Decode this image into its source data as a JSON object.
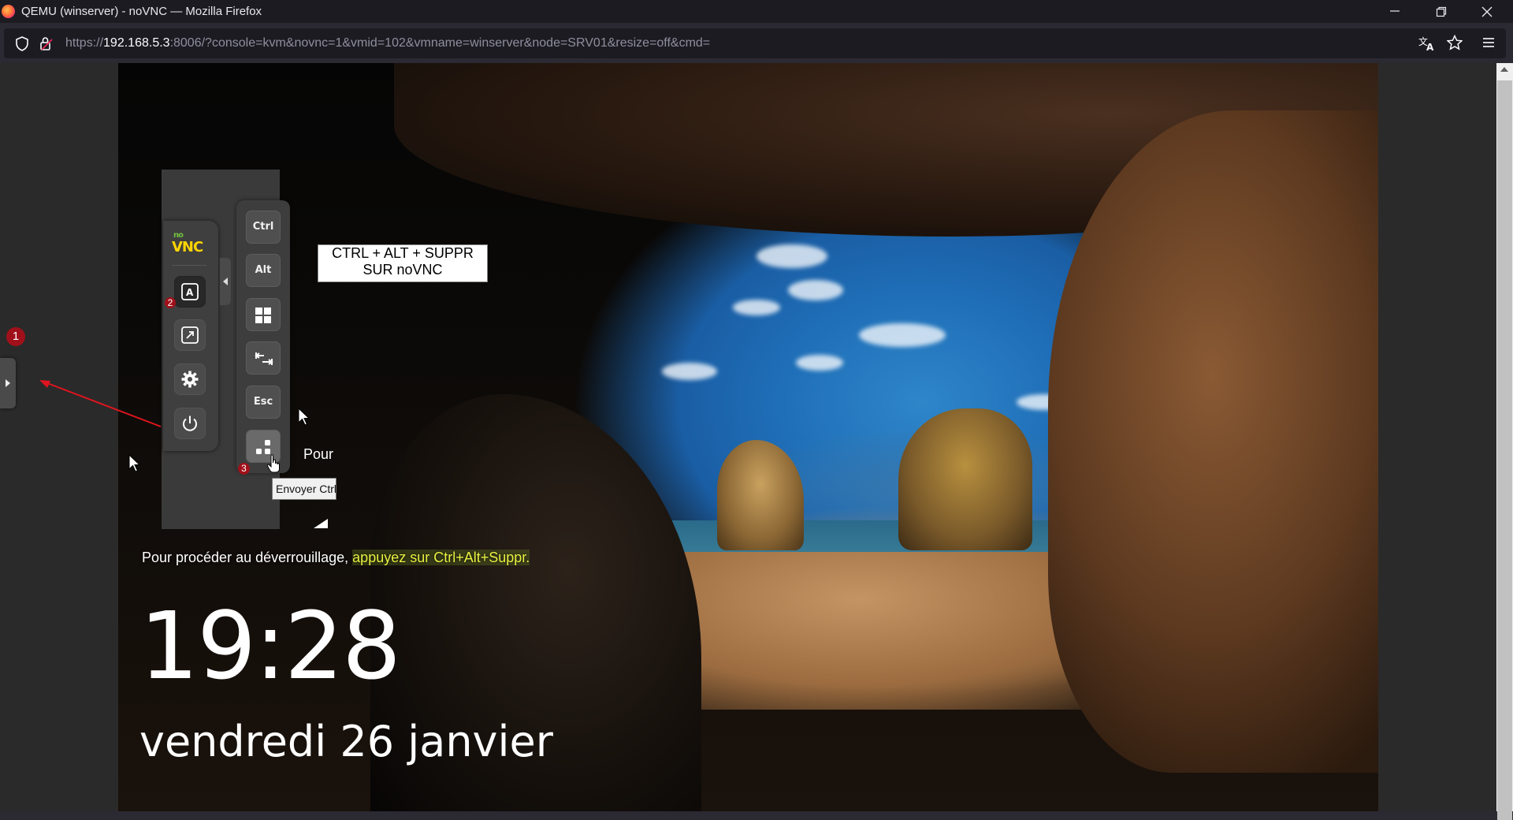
{
  "window": {
    "title": "QEMU (winserver) - noVNC — Mozilla Firefox"
  },
  "urlbar": {
    "url_prefix": "https://",
    "url_host": "192.168.5.3",
    "url_rest": ":8006/?console=kvm&novnc=1&vmid=102&vmname=winserver&node=SRV01&resize=off&cmd="
  },
  "novnc": {
    "logo_no": "no",
    "logo_vnc": "VNC",
    "extra_keys": {
      "ctrl": "Ctrl",
      "alt": "Alt",
      "esc": "Esc"
    },
    "tooltip": "Envoyer Ctrl"
  },
  "annotations": {
    "box_line1": "CTRL + ALT + SUPPR",
    "box_line2": "SUR noVNC",
    "badge1": "1",
    "badge2": "2",
    "badge3": "3",
    "arrow_color": "#e0141e"
  },
  "lockscreen": {
    "pour_partial": "Pour",
    "unlock_text": "Pour procéder au déverrouillage, ",
    "unlock_highlight": "appuyez sur Ctrl+Alt+Suppr.",
    "time": "19:28",
    "date": "vendredi 26 janvier"
  },
  "icons": {
    "window_controls": [
      "minimize-icon",
      "restore-icon",
      "close-icon"
    ],
    "nav": [
      "shield-icon",
      "lock-icon",
      "translate-icon",
      "star-icon",
      "menu-icon"
    ]
  }
}
